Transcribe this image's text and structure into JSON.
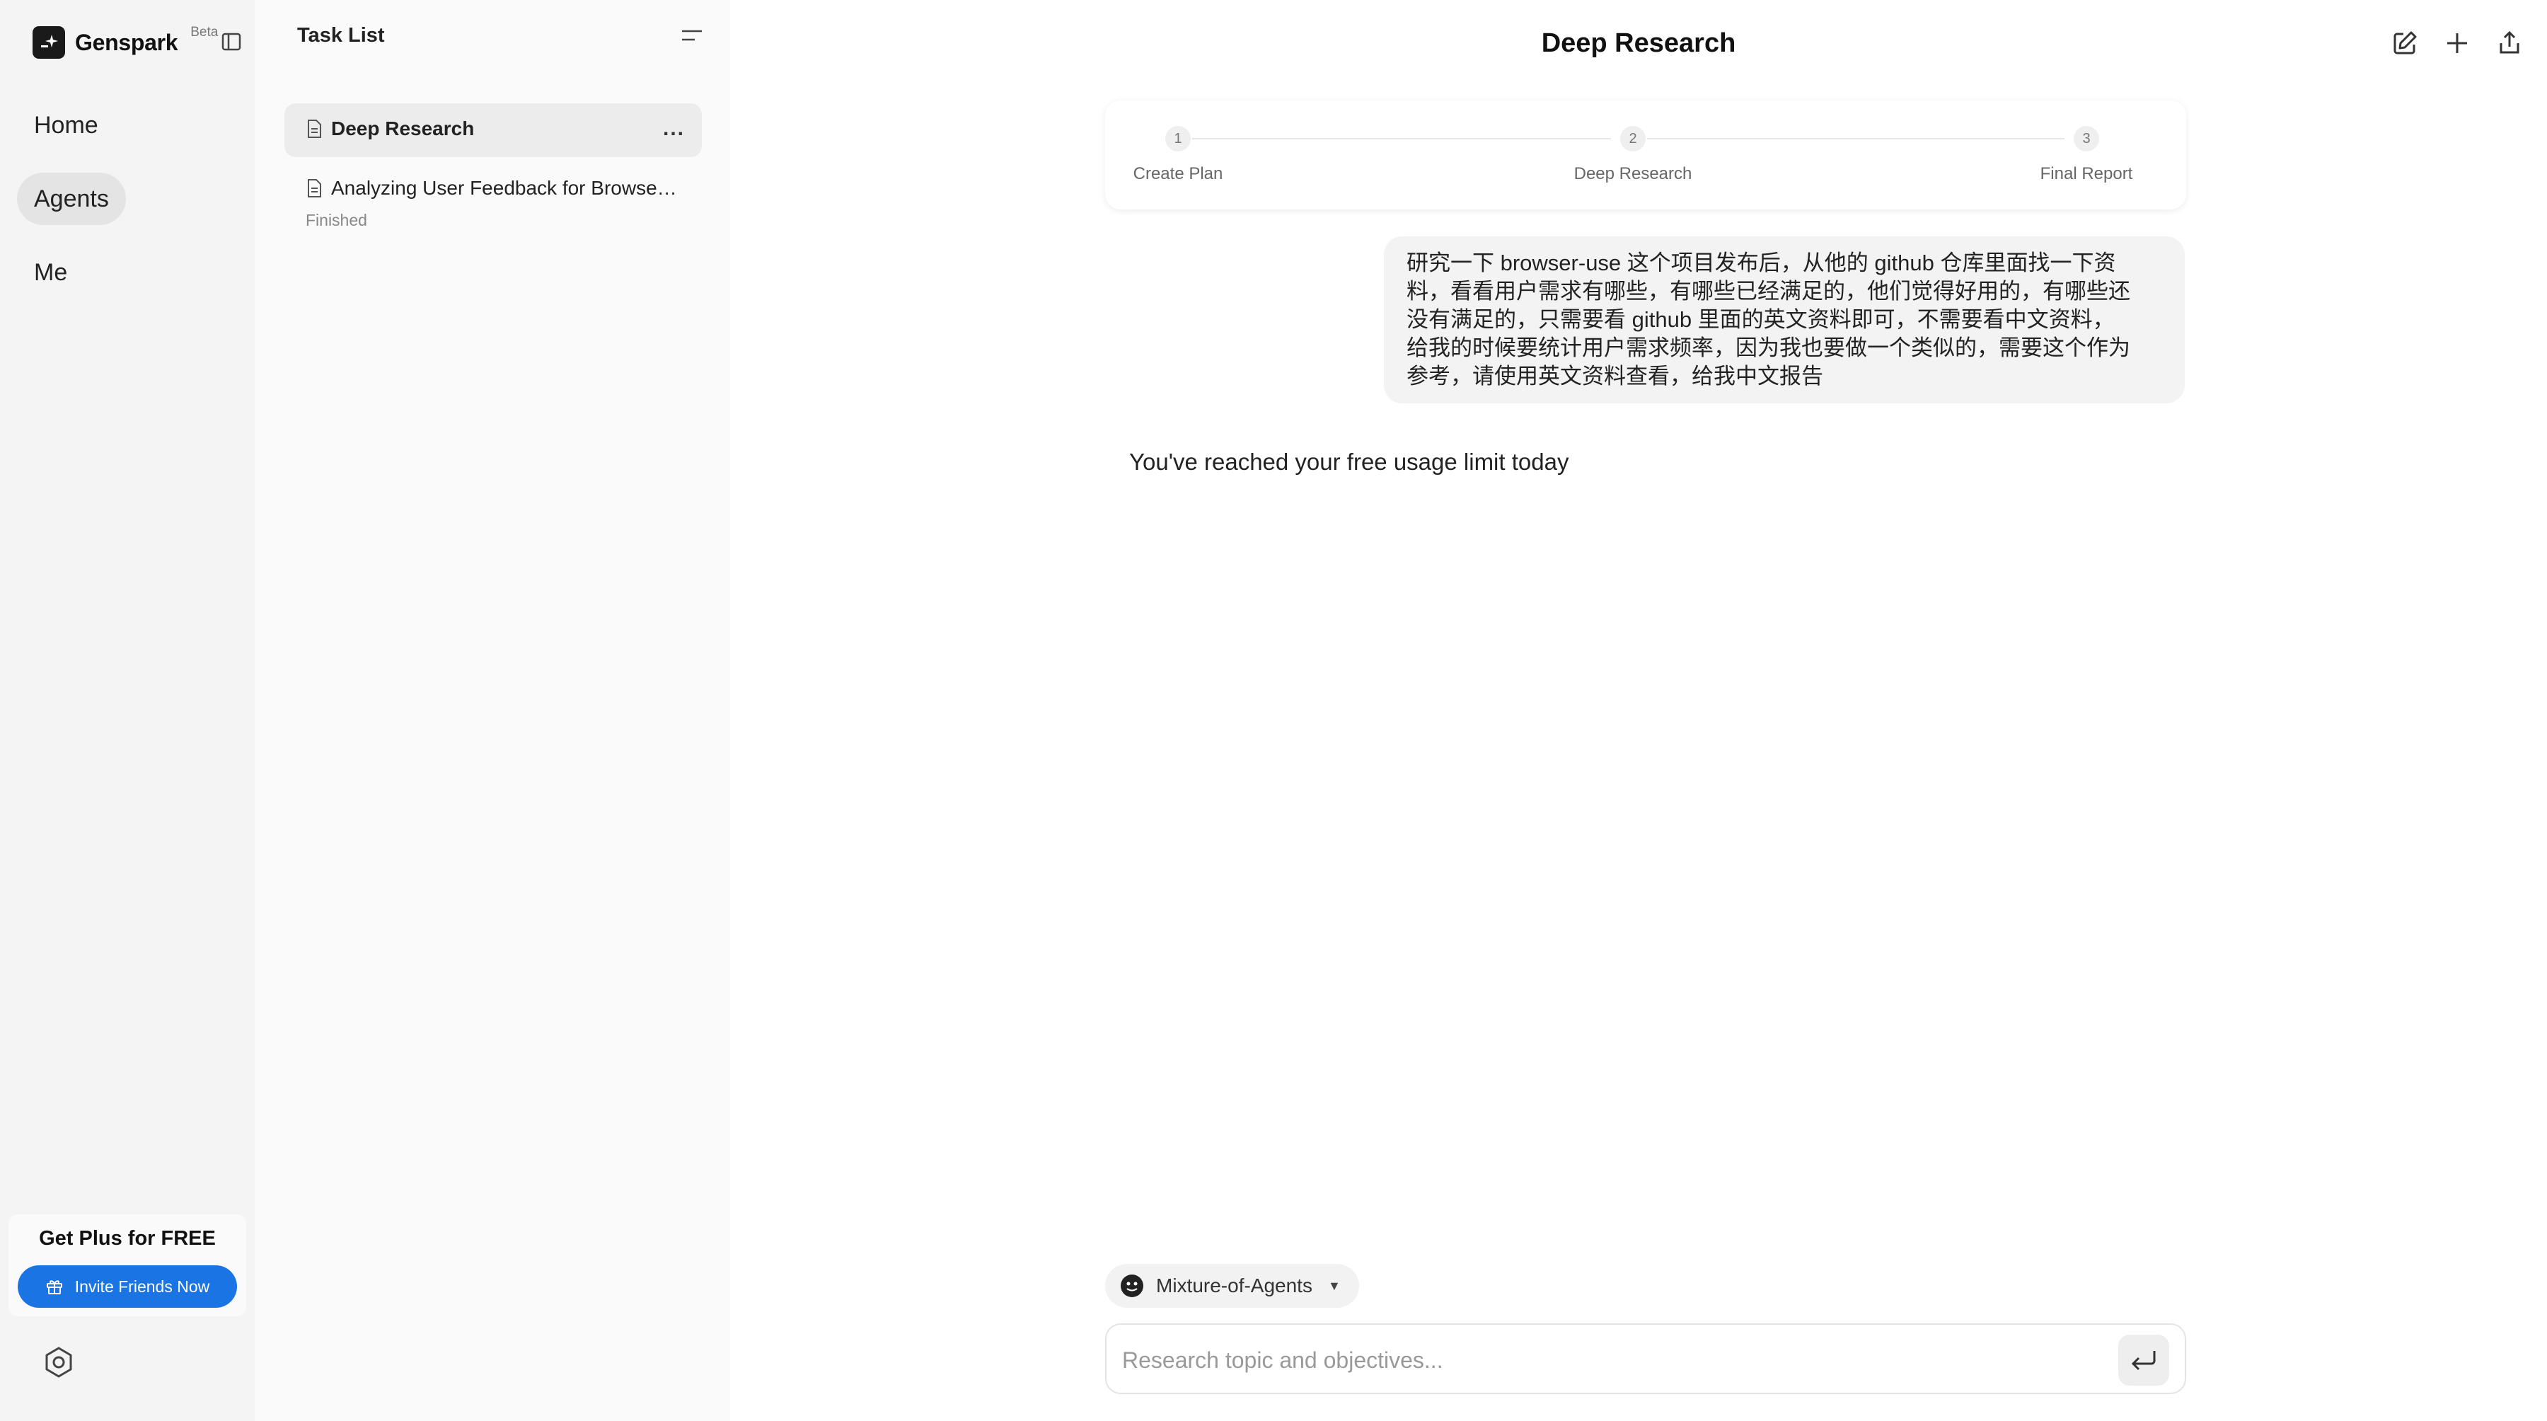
{
  "brand": {
    "name": "Genspark",
    "badge": "Beta"
  },
  "nav": {
    "items": [
      {
        "label": "Home",
        "active": false
      },
      {
        "label": "Agents",
        "active": true
      },
      {
        "label": "Me",
        "active": false
      }
    ],
    "promo": {
      "title": "Get Plus for FREE",
      "button_label": "Invite Friends Now"
    }
  },
  "task_list": {
    "title": "Task List",
    "items": [
      {
        "title": "Deep Research",
        "status": "",
        "selected": true
      },
      {
        "title": "Analyzing User Feedback for Browse…",
        "status": "Finished",
        "selected": false
      }
    ]
  },
  "main": {
    "title": "Deep Research",
    "steps": [
      {
        "number": "1",
        "label": "Create Plan"
      },
      {
        "number": "2",
        "label": "Deep Research"
      },
      {
        "number": "3",
        "label": "Final Report"
      }
    ],
    "user_message_lines": [
      "研究一下 browser-use 这个项目发布后，从他的 github 仓库里面找一下资",
      "料，看看用户需求有哪些，有哪些已经满足的，他们觉得好用的，有哪些还",
      "没有满足的，只需要看 github 里面的英文资料即可，不需要看中文资料，",
      "给我的时候要统计用户需求频率，因为我也要做一个类似的，需要这个作为",
      "参考，请使用英文资料查看，给我中文报告"
    ],
    "limit_message": "You've reached your free usage limit today",
    "model_selector": {
      "label": "Mixture-of-Agents",
      "caret": "▼"
    },
    "input": {
      "placeholder": "Research topic and objectives...",
      "value": ""
    }
  },
  "icons": {
    "collapse_sidebar": "sidebar-toggle-icon",
    "collapse_tasks": "collapse-lines-icon",
    "settings": "settings-icon",
    "edit": "edit-icon",
    "new": "plus-icon",
    "share": "share-icon",
    "send": "enter-icon"
  },
  "colors": {
    "accent": "#1b74e4",
    "nav_bg": "#f4f4f4",
    "task_bg": "#fafafa"
  }
}
